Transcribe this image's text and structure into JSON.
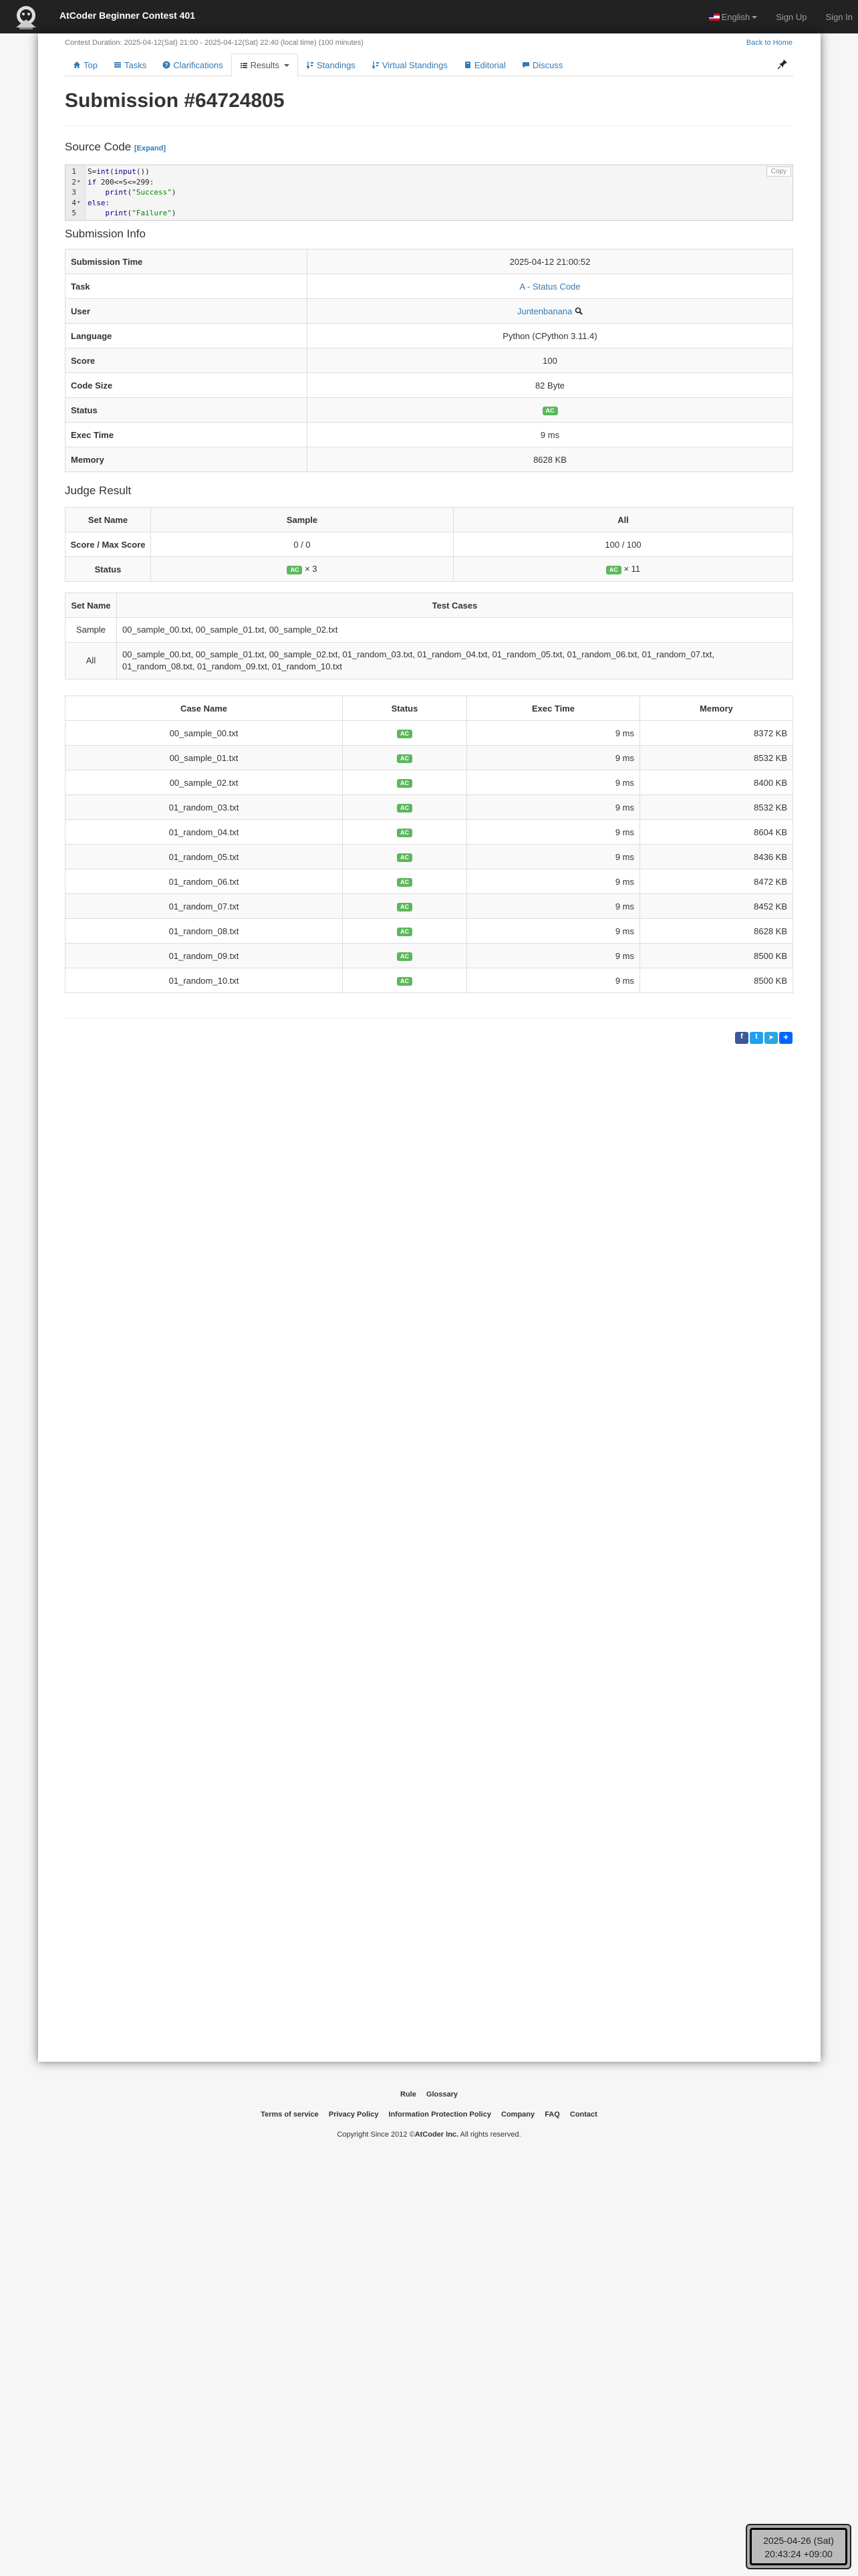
{
  "navbar": {
    "brand": "AtCoder Beginner Contest 401",
    "language": "English",
    "sign_up": "Sign Up",
    "sign_in": "Sign In"
  },
  "contest_info": "Contest Duration: 2025-04-12(Sat) 21:00 - 2025-04-12(Sat) 22:40 (local time) (100 minutes)",
  "back_home": "Back to Home",
  "tabs": {
    "top": "Top",
    "tasks": "Tasks",
    "clarifications": "Clarifications",
    "results": "Results",
    "standings": "Standings",
    "virtual_standings": "Virtual Standings",
    "editorial": "Editorial",
    "discuss": "Discuss"
  },
  "title": "Submission #64724805",
  "source_code": {
    "heading": "Source Code",
    "expand": "[Expand]",
    "copy": "Copy",
    "lines": [
      {
        "n": "1",
        "fold": "",
        "pre": "S=",
        "kw1": "int",
        "mid": "(",
        "kw2": "input",
        "post": "())",
        "str": ""
      },
      {
        "n": "2",
        "fold": "▾",
        "pre": "",
        "kw1": "if",
        "mid": " 200<=S<=299:",
        "kw2": "",
        "post": "",
        "str": ""
      },
      {
        "n": "3",
        "fold": "",
        "pre": "    ",
        "kw1": "print",
        "mid": "(",
        "kw2": "",
        "post": ")",
        "str": "\"Success\""
      },
      {
        "n": "4",
        "fold": "▾",
        "pre": "",
        "kw1": "else",
        "mid": ":",
        "kw2": "",
        "post": "",
        "str": ""
      },
      {
        "n": "5",
        "fold": "",
        "pre": "    ",
        "kw1": "print",
        "mid": "(",
        "kw2": "",
        "post": ")",
        "str": "\"Failure\""
      }
    ]
  },
  "submission_info": {
    "heading": "Submission Info",
    "rows": [
      {
        "label": "Submission Time",
        "value": "2025-04-12 21:00:52"
      },
      {
        "label": "Task",
        "value": "A - Status Code"
      },
      {
        "label": "User",
        "value": "Juntenbanana"
      },
      {
        "label": "Language",
        "value": "Python (CPython 3.11.4)"
      },
      {
        "label": "Score",
        "value": "100"
      },
      {
        "label": "Code Size",
        "value": "82 Byte"
      },
      {
        "label": "Status",
        "value": "AC"
      },
      {
        "label": "Exec Time",
        "value": "9 ms"
      },
      {
        "label": "Memory",
        "value": "8628 KB"
      }
    ]
  },
  "judge_result": {
    "heading": "Judge Result",
    "headers": [
      "Set Name",
      "Sample",
      "All"
    ],
    "score_label": "Score / Max Score",
    "sample_score": "0 / 0",
    "all_score": "100 / 100",
    "status_label": "Status",
    "status_badge": "AC",
    "sample_count": "× 3",
    "all_count": "× 11"
  },
  "set_table": {
    "headers": [
      "Set Name",
      "Test Cases"
    ],
    "rows": [
      {
        "name": "Sample",
        "cases": "00_sample_00.txt, 00_sample_01.txt, 00_sample_02.txt"
      },
      {
        "name": "All",
        "cases": "00_sample_00.txt, 00_sample_01.txt, 00_sample_02.txt, 01_random_03.txt, 01_random_04.txt, 01_random_05.txt, 01_random_06.txt, 01_random_07.txt, 01_random_08.txt, 01_random_09.txt, 01_random_10.txt"
      }
    ]
  },
  "case_table": {
    "headers": [
      "Case Name",
      "Status",
      "Exec Time",
      "Memory"
    ],
    "rows": [
      {
        "name": "00_sample_00.txt",
        "status": "AC",
        "time": "9 ms",
        "memory": "8372 KB"
      },
      {
        "name": "00_sample_01.txt",
        "status": "AC",
        "time": "9 ms",
        "memory": "8532 KB"
      },
      {
        "name": "00_sample_02.txt",
        "status": "AC",
        "time": "9 ms",
        "memory": "8400 KB"
      },
      {
        "name": "01_random_03.txt",
        "status": "AC",
        "time": "9 ms",
        "memory": "8532 KB"
      },
      {
        "name": "01_random_04.txt",
        "status": "AC",
        "time": "9 ms",
        "memory": "8604 KB"
      },
      {
        "name": "01_random_05.txt",
        "status": "AC",
        "time": "9 ms",
        "memory": "8436 KB"
      },
      {
        "name": "01_random_06.txt",
        "status": "AC",
        "time": "9 ms",
        "memory": "8472 KB"
      },
      {
        "name": "01_random_07.txt",
        "status": "AC",
        "time": "9 ms",
        "memory": "8452 KB"
      },
      {
        "name": "01_random_08.txt",
        "status": "AC",
        "time": "9 ms",
        "memory": "8628 KB"
      },
      {
        "name": "01_random_09.txt",
        "status": "AC",
        "time": "9 ms",
        "memory": "8500 KB"
      },
      {
        "name": "01_random_10.txt",
        "status": "AC",
        "time": "9 ms",
        "memory": "8500 KB"
      }
    ]
  },
  "footer": {
    "row1": [
      "Rule",
      "Glossary"
    ],
    "row2": [
      "Terms of service",
      "Privacy Policy",
      "Information Protection Policy",
      "Company",
      "FAQ",
      "Contact"
    ],
    "copyright_prefix": "Copyright Since 2012 ©",
    "copyright_company": "AtCoder Inc.",
    "copyright_suffix": " All rights reserved."
  },
  "clock": {
    "date": "2025-04-26 (Sat)",
    "time": "20:43:24 +09:00"
  },
  "colors": {
    "navbar": "#222222",
    "link": "#337ab7",
    "ac_badge": "#5cb85c"
  }
}
